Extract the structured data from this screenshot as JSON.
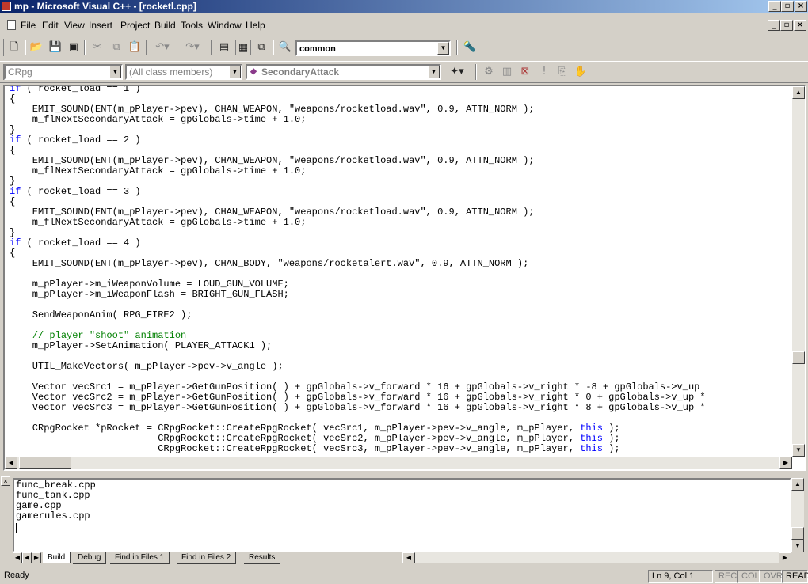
{
  "window": {
    "title": "mp - Microsoft Visual C++ - [rocketl.cpp]",
    "caption_buttons": [
      "minimize-icon",
      "restore-icon",
      "close-icon"
    ]
  },
  "menu": {
    "items": [
      "File",
      "Edit",
      "View",
      "Insert",
      "Project",
      "Build",
      "Tools",
      "Window",
      "Help"
    ]
  },
  "toolbar": {
    "find_combo_value": "common"
  },
  "wizardbar": {
    "class_combo": "CRpg",
    "members_combo": "(All class members)",
    "function_combo": "SecondaryAttack"
  },
  "editor": {
    "filename": "rocketl.cpp",
    "lines": [
      [
        [
          "kw",
          "if"
        ],
        [
          "t",
          " ( rocket_load == 1 )"
        ]
      ],
      [
        [
          "t",
          "{"
        ]
      ],
      [
        [
          "t",
          "    EMIT_SOUND(ENT(m_pPlayer->pev), CHAN_WEAPON, \"weapons/rocketload.wav\", 0.9, ATTN_NORM );"
        ]
      ],
      [
        [
          "t",
          "    m_flNextSecondaryAttack = gpGlobals->time + 1.0;"
        ]
      ],
      [
        [
          "t",
          "}"
        ]
      ],
      [
        [
          "kw",
          "if"
        ],
        [
          "t",
          " ( rocket_load == 2 )"
        ]
      ],
      [
        [
          "t",
          "{"
        ]
      ],
      [
        [
          "t",
          "    EMIT_SOUND(ENT(m_pPlayer->pev), CHAN_WEAPON, \"weapons/rocketload.wav\", 0.9, ATTN_NORM );"
        ]
      ],
      [
        [
          "t",
          "    m_flNextSecondaryAttack = gpGlobals->time + 1.0;"
        ]
      ],
      [
        [
          "t",
          "}"
        ]
      ],
      [
        [
          "kw",
          "if"
        ],
        [
          "t",
          " ( rocket_load == 3 )"
        ]
      ],
      [
        [
          "t",
          "{"
        ]
      ],
      [
        [
          "t",
          "    EMIT_SOUND(ENT(m_pPlayer->pev), CHAN_WEAPON, \"weapons/rocketload.wav\", 0.9, ATTN_NORM );"
        ]
      ],
      [
        [
          "t",
          "    m_flNextSecondaryAttack = gpGlobals->time + 1.0;"
        ]
      ],
      [
        [
          "t",
          "}"
        ]
      ],
      [
        [
          "kw",
          "if"
        ],
        [
          "t",
          " ( rocket_load == 4 )"
        ]
      ],
      [
        [
          "t",
          "{"
        ]
      ],
      [
        [
          "t",
          "    EMIT_SOUND(ENT(m_pPlayer->pev), CHAN_BODY, \"weapons/rocketalert.wav\", 0.9, ATTN_NORM );"
        ]
      ],
      [
        [
          "t",
          ""
        ]
      ],
      [
        [
          "t",
          "    m_pPlayer->m_iWeaponVolume = LOUD_GUN_VOLUME;"
        ]
      ],
      [
        [
          "t",
          "    m_pPlayer->m_iWeaponFlash = BRIGHT_GUN_FLASH;"
        ]
      ],
      [
        [
          "t",
          ""
        ]
      ],
      [
        [
          "t",
          "    SendWeaponAnim( RPG_FIRE2 );"
        ]
      ],
      [
        [
          "t",
          ""
        ]
      ],
      [
        [
          "t",
          "    "
        ],
        [
          "cm",
          "// player \"shoot\" animation"
        ]
      ],
      [
        [
          "t",
          "    m_pPlayer->SetAnimation( PLAYER_ATTACK1 );"
        ]
      ],
      [
        [
          "t",
          ""
        ]
      ],
      [
        [
          "t",
          "    UTIL_MakeVectors( m_pPlayer->pev->v_angle );"
        ]
      ],
      [
        [
          "t",
          ""
        ]
      ],
      [
        [
          "t",
          "    Vector vecSrc1 = m_pPlayer->GetGunPosition( ) + gpGlobals->v_forward * 16 + gpGlobals->v_right * -8 + gpGlobals->v_up"
        ]
      ],
      [
        [
          "t",
          "    Vector vecSrc2 = m_pPlayer->GetGunPosition( ) + gpGlobals->v_forward * 16 + gpGlobals->v_right * 0 + gpGlobals->v_up *"
        ]
      ],
      [
        [
          "t",
          "    Vector vecSrc3 = m_pPlayer->GetGunPosition( ) + gpGlobals->v_forward * 16 + gpGlobals->v_right * 8 + gpGlobals->v_up *"
        ]
      ],
      [
        [
          "t",
          ""
        ]
      ],
      [
        [
          "t",
          "    CRpgRocket *pRocket = CRpgRocket::CreateRpgRocket( vecSrc1, m_pPlayer->pev->v_angle, m_pPlayer, "
        ],
        [
          "kw",
          "this"
        ],
        [
          "t",
          " );"
        ]
      ],
      [
        [
          "t",
          "                          CRpgRocket::CreateRpgRocket( vecSrc2, m_pPlayer->pev->v_angle, m_pPlayer, "
        ],
        [
          "kw",
          "this"
        ],
        [
          "t",
          " );"
        ]
      ],
      [
        [
          "t",
          "                          CRpgRocket::CreateRpgRocket( vecSrc3, m_pPlayer->pev->v_angle, m_pPlayer, "
        ],
        [
          "kw",
          "this"
        ],
        [
          "t",
          " );"
        ]
      ]
    ]
  },
  "output": {
    "lines": [
      "func_break.cpp",
      "func_tank.cpp",
      "game.cpp",
      "gamerules.cpp"
    ],
    "tabs": [
      "Build",
      "Debug",
      "Find in Files 1",
      "Find in Files 2",
      "Results"
    ],
    "active_tab": "Build"
  },
  "status": {
    "text": "Ready",
    "position": "Ln 9, Col 1",
    "indicators": [
      "REC",
      "COL",
      "OVR",
      "READ"
    ]
  },
  "colors": {
    "keyword": "#0000ff",
    "comment": "#008000",
    "titlebar_start": "#0a246a",
    "titlebar_end": "#a6caf0"
  }
}
